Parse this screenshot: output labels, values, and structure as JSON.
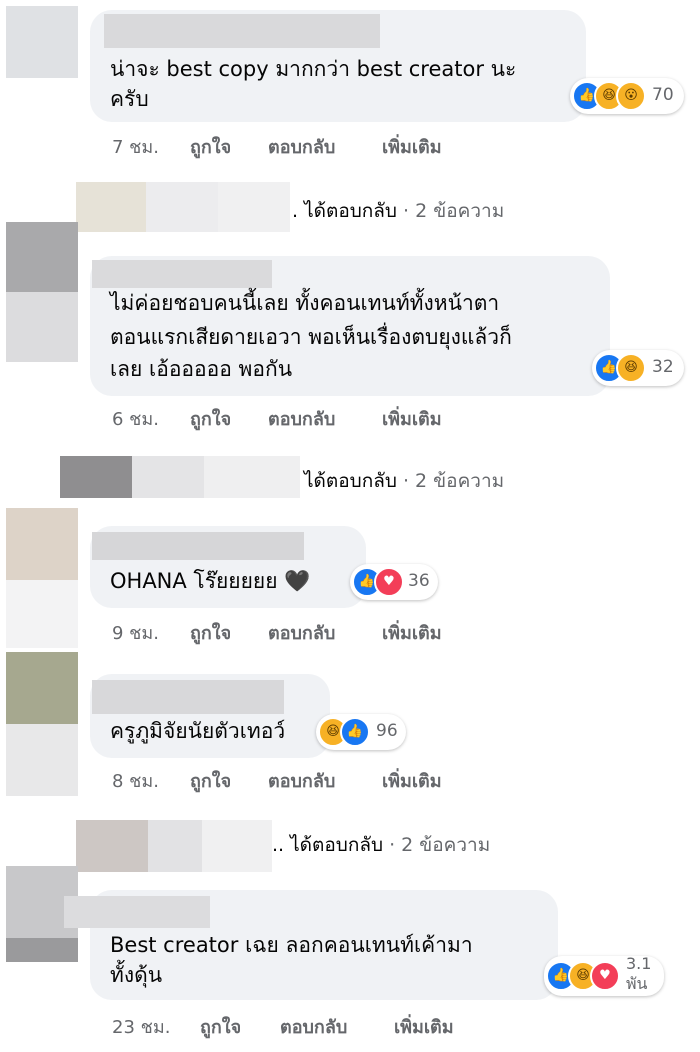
{
  "comments": [
    {
      "text_lines": [
        "น่าจะ best copy มากกว่า best creator นะ",
        "ครับ"
      ],
      "reaction_count": "70",
      "reactions": [
        "like-icon",
        "haha-icon",
        "wow-icon"
      ],
      "time": "7 ชม.",
      "like": "ถูกใจ",
      "reply": "ตอบกลับ",
      "more": "เพิ่มเติม"
    },
    {
      "text_lines": [
        "ไม่ค่อยชอบคนนี้เลย ทั้งคอนเทนท์ทั้งหน้าตา",
        "ตอนแรกเสียดายเอวา พอเห็นเรื่องตบยุงแล้วก็",
        "เลย เอ้อออออ พอกัน"
      ],
      "reaction_count": "32",
      "reactions": [
        "like-icon",
        "haha-icon"
      ],
      "time": "6 ชม.",
      "like": "ถูกใจ",
      "reply": "ตอบกลับ",
      "more": "เพิ่มเติม"
    },
    {
      "text_lines": [
        "OHANA โร๊ยยยยย 🖤"
      ],
      "reaction_count": "36",
      "reactions": [
        "like-icon",
        "love-icon"
      ],
      "time": "9 ชม.",
      "like": "ถูกใจ",
      "reply": "ตอบกลับ",
      "more": "เพิ่มเติม"
    },
    {
      "text_lines": [
        "ครูภูมิจัยนัยตัวเทอว์"
      ],
      "reaction_count": "96",
      "reactions": [
        "haha-icon",
        "like-icon"
      ],
      "time": "8 ชม.",
      "like": "ถูกใจ",
      "reply": "ตอบกลับ",
      "more": "เพิ่มเติม"
    },
    {
      "text_lines": [
        "Best creator เฉย ลอกคอนเทนท์เค้ามา",
        "ทั้งดุ้น"
      ],
      "reaction_count_line1": "3.1",
      "reaction_count_line2": "พัน",
      "reactions": [
        "like-icon",
        "haha-icon",
        "love-icon"
      ],
      "time": "23 ชม.",
      "like": "ถูกใจ",
      "reply": "ตอบกลับ",
      "more": "เพิ่มเติม"
    }
  ],
  "replies": [
    {
      "prefix": ". ได้ตอบกลับ",
      "count": " · 2 ข้อความ"
    },
    {
      "prefix": "ได้ตอบกลับ",
      "count": " · 2 ข้อความ"
    },
    {
      "prefix": ".. ได้ตอบกลับ",
      "count": " · 2 ข้อความ"
    }
  ]
}
